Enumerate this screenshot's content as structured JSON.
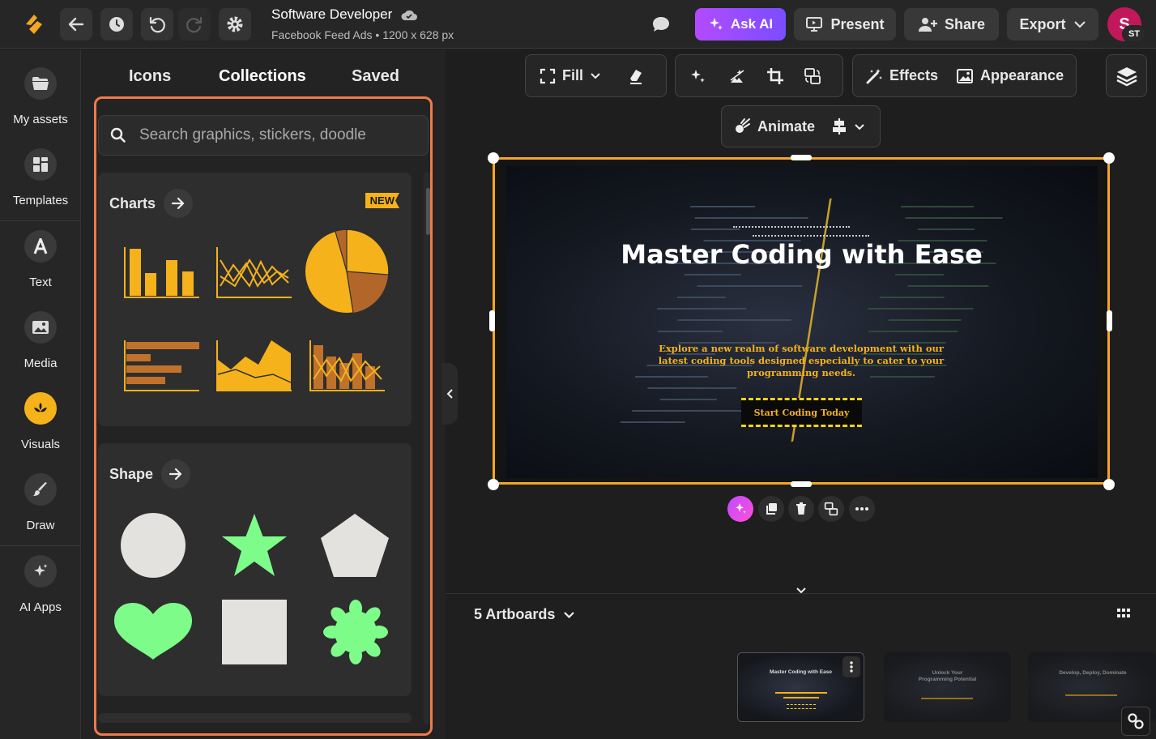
{
  "header": {
    "doc_title": "Software Developer",
    "doc_subtitle": "Facebook Feed Ads • 1200 x 628 px",
    "ask_ai_label": "Ask AI",
    "present_label": "Present",
    "share_label": "Share",
    "export_label": "Export",
    "avatar_initial": "S",
    "avatar_badge": "ST"
  },
  "rail": {
    "items": [
      {
        "label": "My assets",
        "icon": "folder-icon"
      },
      {
        "label": "Templates",
        "icon": "grid-icon"
      },
      {
        "label": "Text",
        "icon": "letter-a-icon"
      },
      {
        "label": "Media",
        "icon": "image-icon"
      },
      {
        "label": "Visuals",
        "icon": "visuals-icon"
      },
      {
        "label": "Draw",
        "icon": "brush-icon"
      },
      {
        "label": "AI Apps",
        "icon": "sparkle-icon"
      }
    ],
    "active": "Visuals"
  },
  "panel": {
    "tabs": [
      "Icons",
      "Collections",
      "Saved"
    ],
    "active_tab": "Collections",
    "search_placeholder": "Search graphics, stickers, doodle",
    "charts_title": "Charts",
    "new_badge": "NEW",
    "shape_title": "Shape"
  },
  "toolbar": {
    "fill_label": "Fill",
    "effects_label": "Effects",
    "appearance_label": "Appearance",
    "animate_label": "Animate"
  },
  "artboard": {
    "headline": "Master Coding with Ease",
    "subtext": "Explore a new realm of software development with our latest coding tools designed especially to cater to your programming needs.",
    "cta": "Start Coding Today"
  },
  "bottom": {
    "artboards_label": "5 Artboards",
    "thumbs": [
      "Master Coding with Ease",
      "Unlock Your Programming Potential",
      "Develop, Deploy, Dominate"
    ]
  },
  "colors": {
    "accent": "#f5b21b",
    "selection": "#f5a623",
    "highlight_box": "#f07a4a",
    "shape_green": "#7dfc8a",
    "shape_gray": "#e4e2df"
  }
}
